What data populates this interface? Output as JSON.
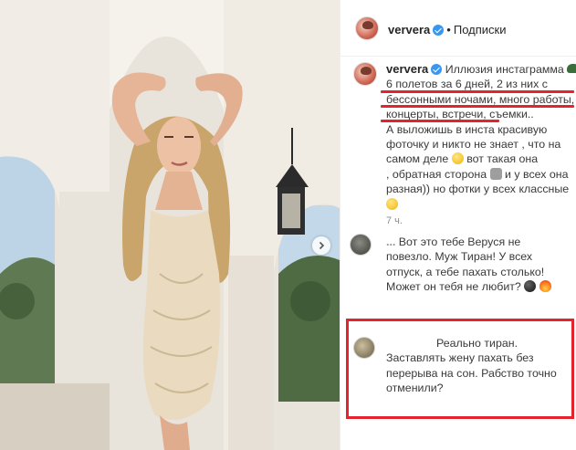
{
  "post": {
    "username": "ververa",
    "follow_label": "Подписки",
    "separator": "•"
  },
  "caption": {
    "username": "ververa",
    "lines": [
      "Иллюзия инстаграмма",
      "6 полетов за 6 дней, 2 из них с",
      "бессонными ночами, много работы,",
      "концерты, встречи, съемки..",
      "А выложишь в инста красивую",
      "фоточку и никто не знает , что на",
      "самом деле",
      "вот такая она",
      ", обратная сторона",
      "и у всех она",
      "разная)) но фотки у всех классные"
    ],
    "timestamp": "7 ч."
  },
  "comments": [
    {
      "prefix": "...",
      "lines": [
        "Вот это тебе Веруся не",
        "повезло. Муж Тиран! У всех",
        "отпуск, а тебе пахать столько!",
        "Может он тебя не любит?"
      ]
    },
    {
      "lines": [
        "Реально тиран.",
        "Заставлять жену пахать без",
        "перерыва на сон. Рабство точно",
        "отменили?"
      ]
    }
  ],
  "icons": {
    "verified": "verified-badge-icon",
    "carousel": "chevron-right-icon",
    "emoji_plane": "airplane-emoji-icon",
    "emoji_grin": "grinning-face-emoji-icon",
    "emoji_gesture": "person-gesturing-emoji-icon",
    "emoji_smile": "smiling-face-emoji-icon",
    "emoji_bomb": "bomb-emoji-icon",
    "emoji_fire": "fire-emoji-icon"
  },
  "colors": {
    "annotation_red": "#e4242c",
    "verified_blue": "#3897f0",
    "muted_text": "#8e8e8e"
  }
}
